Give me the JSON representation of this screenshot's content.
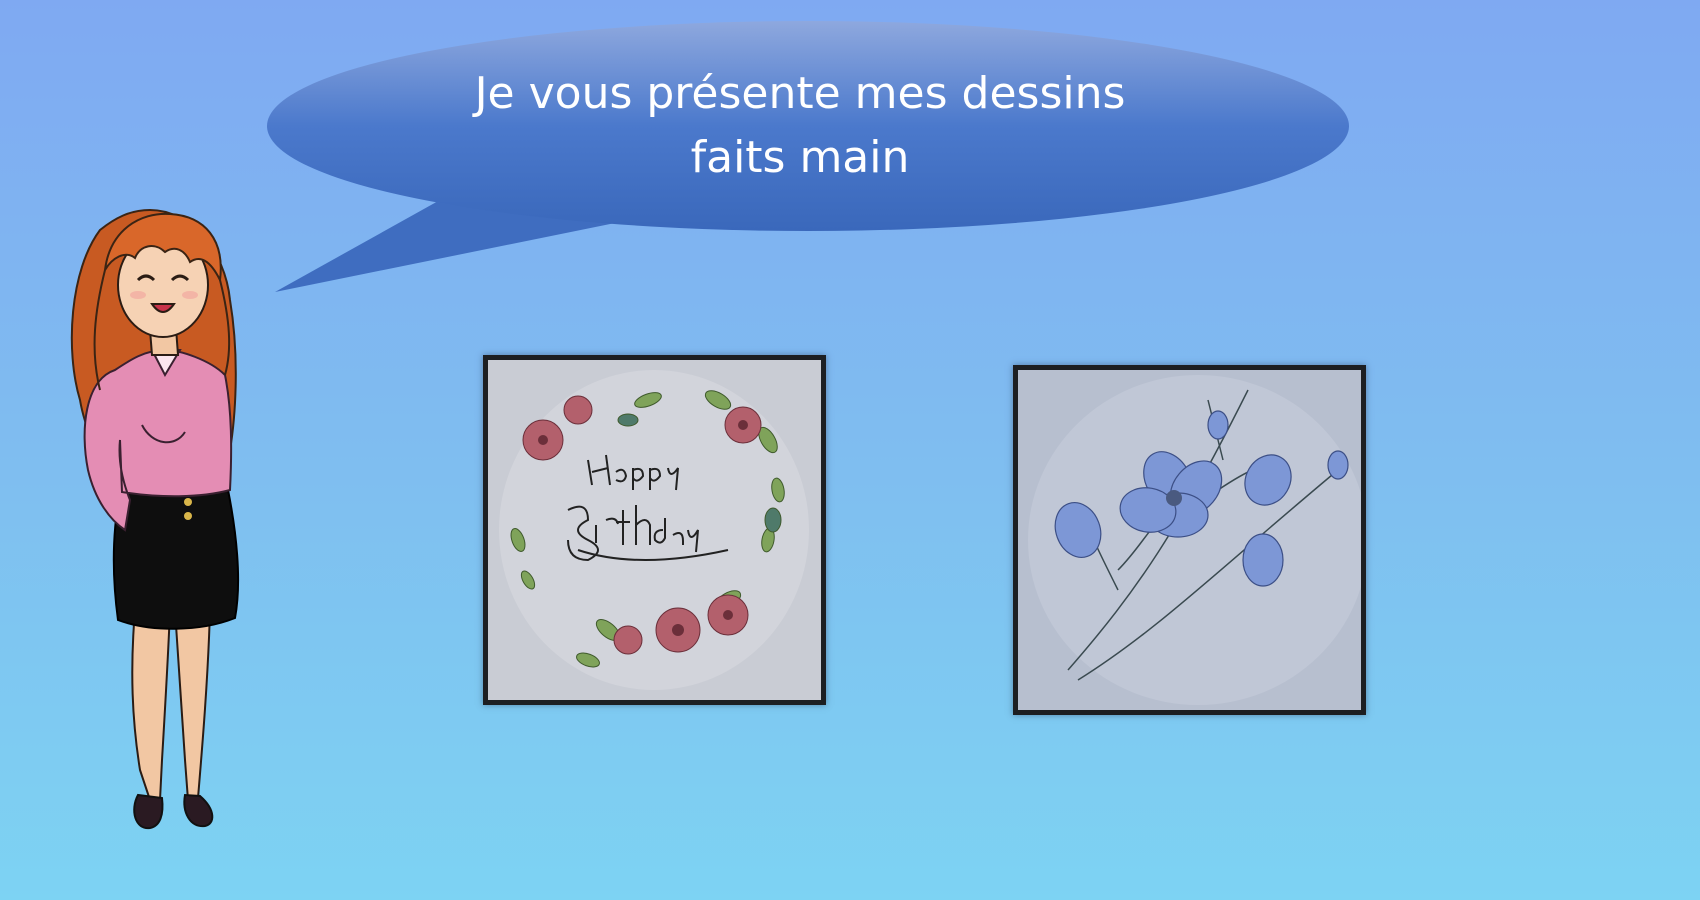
{
  "speech": {
    "lines": [
      "Je vous présente mes dessins",
      "faits main"
    ]
  },
  "drawings": [
    {
      "subject": "birthday-flower-wreath",
      "lettering": "Happy Birthday"
    },
    {
      "subject": "blue-cosmos-flowers"
    }
  ],
  "colors": {
    "bubble_top": "#8aa4dc",
    "bubble_bottom": "#3d6fc4",
    "frame": "#1d1f22",
    "hair": "#d9672a",
    "blouse": "#e48db4",
    "skirt": "#0d0d0d"
  }
}
